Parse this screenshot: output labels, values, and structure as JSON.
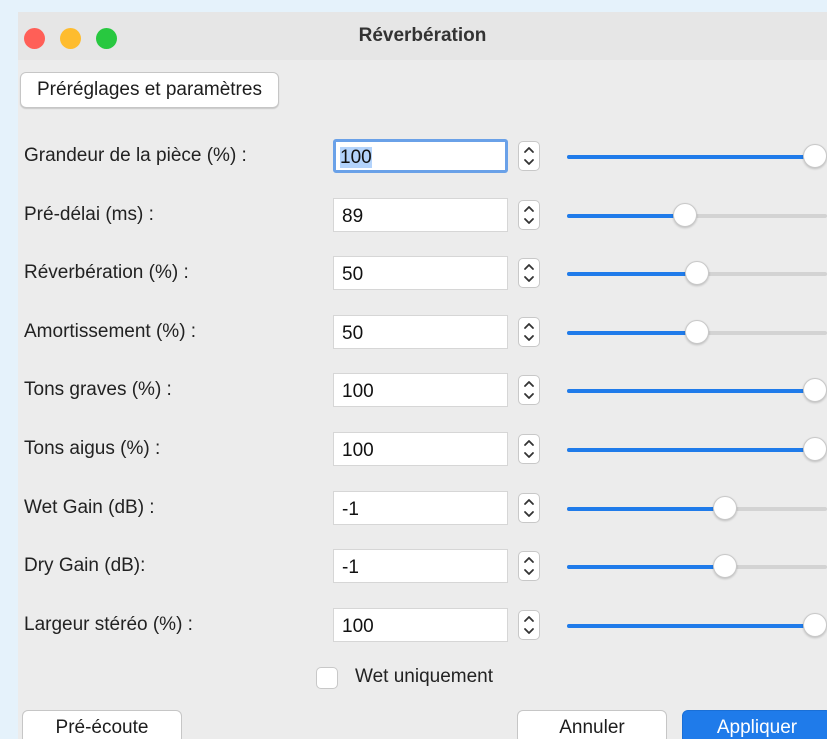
{
  "window": {
    "title": "Réverbération",
    "controls": [
      "close",
      "minimize",
      "zoom"
    ]
  },
  "toolbar": {
    "presets_label": "Préréglages et paramètres"
  },
  "params": [
    {
      "label": "Grandeur de la pièce (%) :",
      "value": "100",
      "slider_fraction": 1.0,
      "focused": true
    },
    {
      "label": "Pré-délai (ms) :",
      "value": "89",
      "slider_fraction": 0.45
    },
    {
      "label": "Réverbération (%) :",
      "value": "50",
      "slider_fraction": 0.5
    },
    {
      "label": "Amortissement (%) :",
      "value": "50",
      "slider_fraction": 0.5
    },
    {
      "label": "Tons graves (%) :",
      "value": "100",
      "slider_fraction": 1.0
    },
    {
      "label": "Tons aigus (%) :",
      "value": "100",
      "slider_fraction": 1.0
    },
    {
      "label": "Wet Gain (dB) :",
      "value": "-1",
      "slider_fraction": 0.62
    },
    {
      "label": "Dry Gain (dB):",
      "value": "-1",
      "slider_fraction": 0.62
    },
    {
      "label": "Largeur stéréo (%) :",
      "value": "100",
      "slider_fraction": 1.0
    }
  ],
  "wet_only": {
    "label": "Wet uniquement",
    "checked": false
  },
  "buttons": {
    "preview": "Pré-écoute",
    "cancel": "Annuler",
    "apply": "Appliquer"
  },
  "colors": {
    "accent": "#1f7bea",
    "close": "#ff5f57",
    "minimize": "#febc2e",
    "zoom": "#28c840",
    "background": "#e5f2fb"
  }
}
